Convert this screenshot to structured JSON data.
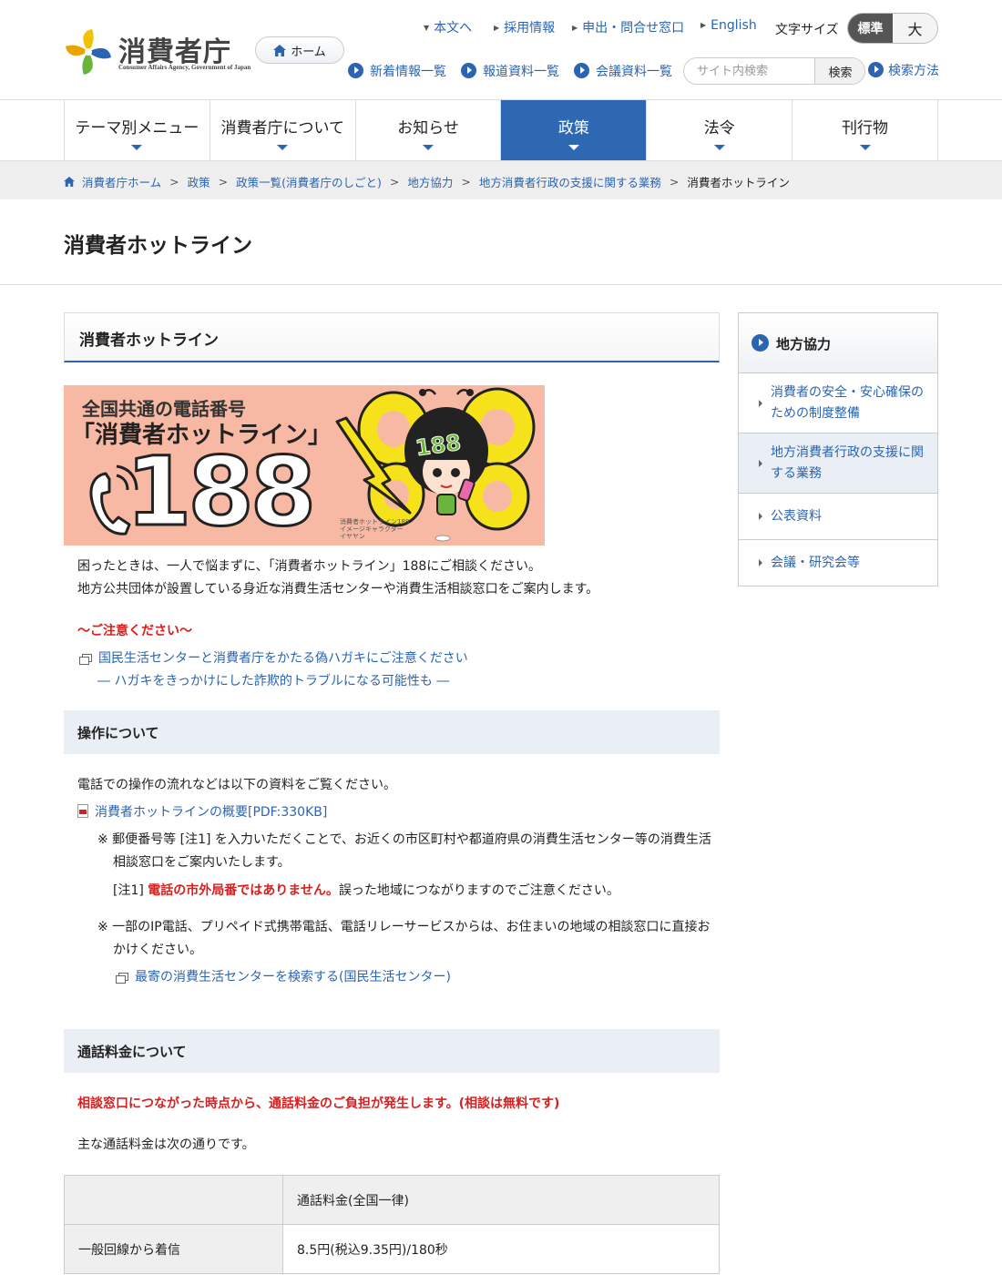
{
  "header": {
    "logo_title": "消費者庁",
    "logo_subtitle": "Consumer Affairs Agency, Government of Japan",
    "home_label": "ホーム",
    "util_links": [
      "本文へ",
      "採用情報",
      "申出・問合せ窓口",
      "English"
    ],
    "font_size_label": "文字サイズ",
    "font_size_standard": "標準",
    "font_size_large": "大",
    "quick_links": [
      "新着情報一覧",
      "報道資料一覧",
      "会議資料一覧"
    ],
    "search_placeholder": "サイト内検索",
    "search_button": "検索",
    "search_help": "検索方法"
  },
  "gnav": {
    "items": [
      "テーマ別メニュー",
      "消費者庁について",
      "お知らせ",
      "政策",
      "法令",
      "刊行物"
    ],
    "active": "政策"
  },
  "breadcrumb": [
    "消費者庁ホーム",
    "政策",
    "政策一覧(消費者庁のしごと)",
    "地方協力",
    "地方消費者行政の支援に関する業務",
    "消費者ホットライン"
  ],
  "page_title": "消費者ホットライン",
  "main": {
    "section_title": "消費者ホットライン",
    "banner": {
      "line1": "全国共通の電話番号",
      "line2": "「消費者ホットライン」",
      "number": "188",
      "badge": "188",
      "caption": [
        "消費者ホットライン188",
        "イメージキャラクター",
        "イヤヤン"
      ]
    },
    "intro": [
      "困ったときは、一人で悩まずに、「消費者ホットライン」188にご相談ください。",
      "地方公共団体が設置している身近な消費生活センターや消費生活相談窓口をご案内します。"
    ],
    "caution_title": "〜ご注意ください〜",
    "caution_link": "国民生活センターと消費者庁をかたる偽ハガキにご注意ください",
    "caution_link_sub": "― ハガキをきっかけにした詐欺的トラブルになる可能性も ―",
    "ops": {
      "title": "操作について",
      "text": "電話での操作の流れなどは以下の資料をご覧ください。",
      "pdf_link": "消費者ホットラインの概要[PDF:330KB]",
      "note1_line1": "※ 郵便番号等 [注1] を入力いただくことで、お近くの市区町村や都道府県の消費生活センター等の消費生活",
      "note1_line2": "相談窓口をご案内いたします。",
      "note2_prefix": "[注1] ",
      "note2_red": "電話の市外局番ではありません。",
      "note2_suffix": "誤った地域につながりますのでご注意ください。",
      "note3_line1": "※ 一部のIP電話、プリペイド式携帯電話、電話リレーサービスからは、お住まいの地域の相談窓口に直接お",
      "note3_line2": "かけください。",
      "search_link": "最寄の消費生活センターを検索する(国民生活センター)"
    },
    "fee": {
      "title": "通話料金について",
      "red_text": "相談窓口につながった時点から、通話料金のご負担が発生します。(相談は無料です)",
      "text": "主な通話料金は次の通りです。",
      "table": {
        "header": [
          "",
          "通話料金(全国一律)"
        ],
        "rows": [
          [
            "一般回線から着信",
            "8.5円(税込9.35円)/180秒"
          ]
        ]
      }
    }
  },
  "sidebar": {
    "title": "地方協力",
    "items": [
      "消費者の安全・安心確保のための制度整備",
      "地方消費者行政の支援に関する業務",
      "公表資料",
      "会議・研究会等"
    ],
    "current": "地方消費者行政の支援に関する業務"
  }
}
